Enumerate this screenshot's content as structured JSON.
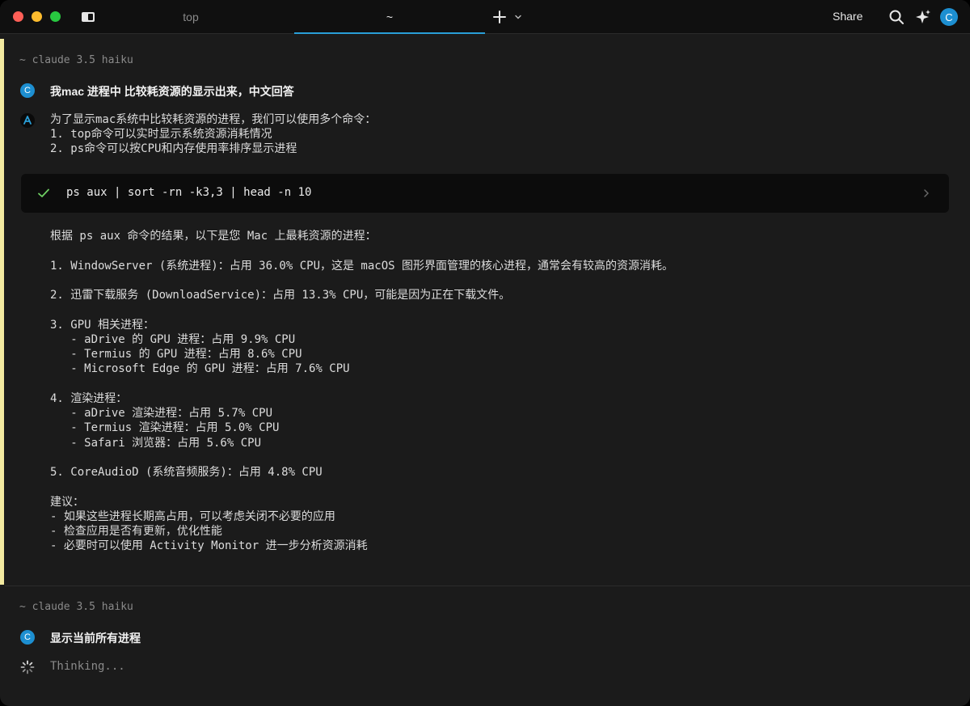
{
  "titlebar": {
    "tabs": [
      {
        "label": "top",
        "active": false
      },
      {
        "label": "~",
        "active": true
      }
    ],
    "share_label": "Share",
    "avatar_letter": "C",
    "icons": [
      "sidebar-toggle-icon",
      "plus-icon",
      "chevron-down-icon",
      "search-icon",
      "sparkle-icon"
    ]
  },
  "conversation": [
    {
      "model": "~ claude 3.5 haiku",
      "user_message": "我mac 进程中 比较耗资源的显示出来，中文回答",
      "assistant_intro": "为了显示mac系统中比较耗资源的进程，我们可以使用多个命令：\n1. top命令可以实时显示系统资源消耗情况\n2. ps命令可以按CPU和内存使用率排序显示进程",
      "command": {
        "text": "ps aux | sort -rn -k3,3 | head -n 10",
        "status": "success"
      },
      "result": "根据 ps aux 命令的结果，以下是您 Mac 上最耗资源的进程：\n\n1. WindowServer (系统进程)：占用 36.0% CPU，这是 macOS 图形界面管理的核心进程，通常会有较高的资源消耗。\n\n2. 迅雷下载服务 (DownloadService)：占用 13.3% CPU，可能是因为正在下载文件。\n\n3. GPU 相关进程：\n   - aDrive 的 GPU 进程：占用 9.9% CPU\n   - Termius 的 GPU 进程：占用 8.6% CPU\n   - Microsoft Edge 的 GPU 进程：占用 7.6% CPU\n\n4. 渲染进程：\n   - aDrive 渲染进程：占用 5.7% CPU\n   - Termius 渲染进程：占用 5.0% CPU\n   - Safari 浏览器：占用 5.6% CPU\n\n5. CoreAudioD (系统音频服务)：占用 4.8% CPU\n\n建议：\n- 如果这些进程长期高占用，可以考虑关闭不必要的应用\n- 检查应用是否有更新，优化性能\n- 必要时可以使用 Activity Monitor 进一步分析资源消耗"
    },
    {
      "model": "~ claude 3.5 haiku",
      "user_message": "显示当前所有进程",
      "status": "Thinking..."
    }
  ],
  "colors": {
    "accent": "#2a9fd8",
    "avatar": "#1d8fd1",
    "active_block_bar": "#f3eaa0",
    "success_check": "#6fcf63"
  }
}
